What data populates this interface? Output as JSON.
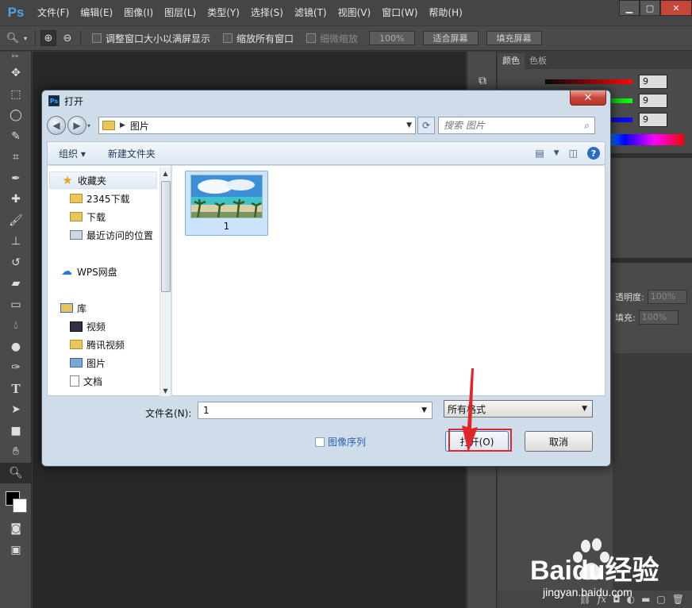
{
  "app": {
    "logo": "Ps",
    "menu": [
      "文件(F)",
      "编辑(E)",
      "图像(I)",
      "图层(L)",
      "类型(Y)",
      "选择(S)",
      "滤镜(T)",
      "视图(V)",
      "窗口(W)",
      "帮助(H)"
    ]
  },
  "options_bar": {
    "resize_windows": "调整窗口大小以满屏显示",
    "zoom_all_windows": "缩放所有窗口",
    "scrubby_zoom": "细微缩放",
    "zoom_100": "100%",
    "fit_screen": "适合屏幕",
    "fill_screen": "填充屏幕"
  },
  "panels": {
    "color_tab": "颜色",
    "swatches_tab": "色板",
    "r_value": "9",
    "g_value": "9",
    "b_value": "9",
    "opacity_label": "透明度:",
    "opacity_value": "100%",
    "fill_label": "填充:",
    "fill_value": "100%"
  },
  "dialog": {
    "title": "打开",
    "address_path": "图片",
    "search_placeholder": "搜索 图片",
    "organize": "组织 ▾",
    "new_folder": "新建文件夹",
    "nav": {
      "favorites": "收藏夹",
      "download_2345": "2345下载",
      "downloads": "下载",
      "recent": "最近访问的位置",
      "wps_cloud": "WPS网盘",
      "libraries": "库",
      "videos": "视频",
      "tencent_video": "腾讯视频",
      "pictures": "图片",
      "documents": "文档"
    },
    "file_name_caption": "1",
    "filename_label": "文件名(N):",
    "filename_value": "1",
    "file_type": "所有格式",
    "image_sequence": "图像序列",
    "open_button": "打开(O)",
    "cancel_button": "取消"
  },
  "watermark": {
    "brand": "Baidu经验",
    "url": "jingyan.baidu.com"
  },
  "colors": {
    "highlight_red": "#e0262a",
    "ps_blue": "#4aa3e8"
  }
}
